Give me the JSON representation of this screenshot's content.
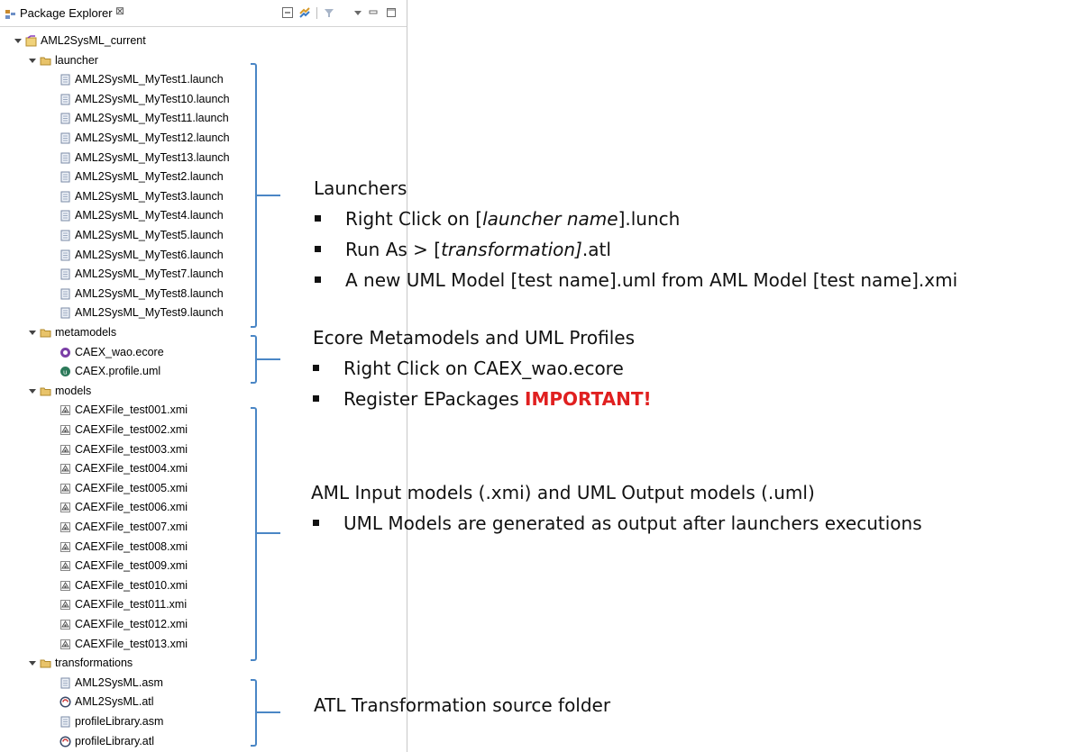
{
  "view": {
    "title": "Package Explorer",
    "close_glyph": "⊠",
    "toolbar": [
      "collapse-all-icon",
      "link-with-editor-icon",
      "filters-icon",
      "view-menu-icon",
      "minimize-icon",
      "maximize-icon"
    ]
  },
  "tree": {
    "project": "AML2SysML_current",
    "folders": [
      {
        "name": "launcher",
        "icon": "folder-icon",
        "children": [
          "AML2SysML_MyTest1.launch",
          "AML2SysML_MyTest10.launch",
          "AML2SysML_MyTest11.launch",
          "AML2SysML_MyTest12.launch",
          "AML2SysML_MyTest13.launch",
          "AML2SysML_MyTest2.launch",
          "AML2SysML_MyTest3.launch",
          "AML2SysML_MyTest4.launch",
          "AML2SysML_MyTest5.launch",
          "AML2SysML_MyTest6.launch",
          "AML2SysML_MyTest7.launch",
          "AML2SysML_MyTest8.launch",
          "AML2SysML_MyTest9.launch"
        ]
      },
      {
        "name": "metamodels",
        "icon": "folder-icon",
        "children": [
          "CAEX_wao.ecore",
          "CAEX.profile.uml"
        ]
      },
      {
        "name": "models",
        "icon": "folder-icon",
        "children": [
          "CAEXFile_test001.xmi",
          "CAEXFile_test002.xmi",
          "CAEXFile_test003.xmi",
          "CAEXFile_test004.xmi",
          "CAEXFile_test005.xmi",
          "CAEXFile_test006.xmi",
          "CAEXFile_test007.xmi",
          "CAEXFile_test008.xmi",
          "CAEXFile_test009.xmi",
          "CAEXFile_test010.xmi",
          "CAEXFile_test011.xmi",
          "CAEXFile_test012.xmi",
          "CAEXFile_test013.xmi"
        ]
      },
      {
        "name": "transformations",
        "icon": "folder-icon",
        "children": [
          "AML2SysML.asm",
          "AML2SysML.atl",
          "profileLibrary.asm",
          "profileLibrary.atl"
        ]
      }
    ]
  },
  "annotations": {
    "launchers": {
      "heading": "Launchers",
      "b1_pre": "Right Click on [",
      "b1_em": "launcher name",
      "b1_post": "].lunch",
      "b2_pre": "Run As > [",
      "b2_em": "transformation]",
      "b2_post": ".atl",
      "b3": "A new UML Model [test name].uml from AML Model [test name].xmi"
    },
    "metamodels": {
      "heading": "Ecore Metamodels and UML Profiles",
      "b1": "Right Click on CAEX_wao.ecore",
      "b2_pre": "Register EPackages ",
      "b2_important": "IMPORTANT!"
    },
    "models": {
      "heading": "AML Input models (.xmi) and UML Output models (.uml)",
      "b1": "UML Models are generated as output after launchers executions"
    },
    "transformations": {
      "heading": "ATL Transformation source folder"
    }
  },
  "colors": {
    "bracket": "#4a86c5",
    "important": "#e02020",
    "folder": "#e8c36a"
  }
}
